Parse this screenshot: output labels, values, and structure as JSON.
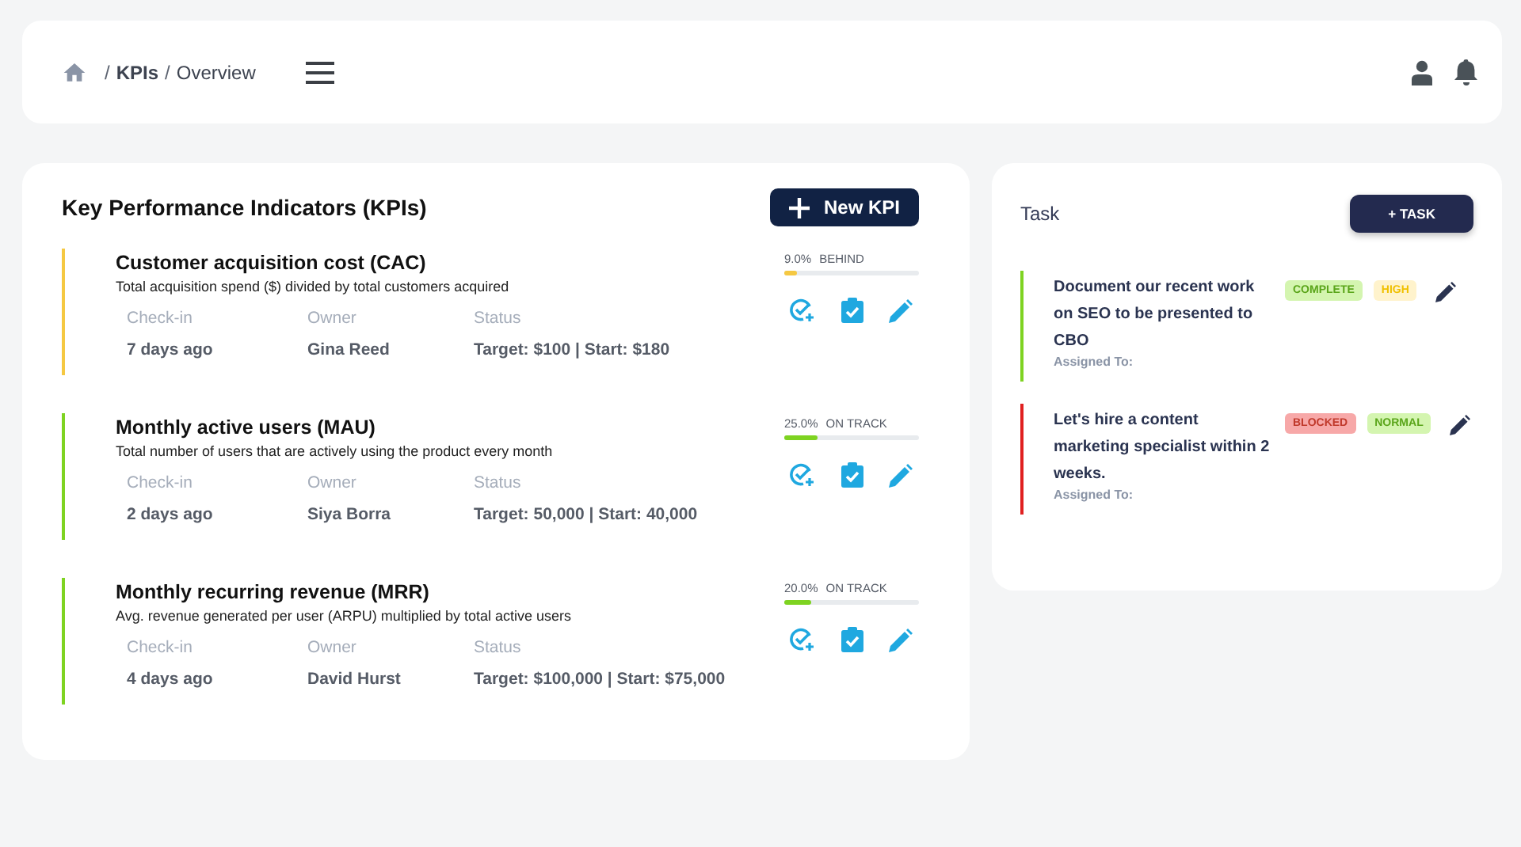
{
  "breadcrumb": {
    "separator": "/",
    "items": [
      {
        "label": "KPIs",
        "current": false
      },
      {
        "label": "Overview",
        "current": true
      }
    ]
  },
  "kpi_panel": {
    "title": "Key Performance Indicators (KPIs)",
    "new_button": "New KPI",
    "kpis": [
      {
        "title": "Customer acquisition cost (CAC)",
        "description": "Total acquisition spend ($) divided by total customers acquired",
        "color": "#f5c842",
        "percent": "9.0%",
        "status": "BEHIND",
        "level": 0.09,
        "checkin_label": "Check-in",
        "owner_label": "Owner",
        "status_label": "Status",
        "checkin": "7 days ago",
        "owner": "Gina Reed",
        "target": "Target: $100 | Start: $180"
      },
      {
        "title": "Monthly active users (MAU)",
        "description": "Total number of users that are actively using the product every month",
        "color": "#7ed321",
        "percent": "25.0%",
        "status": "ON TRACK",
        "level": 0.25,
        "checkin_label": "Check-in",
        "owner_label": "Owner",
        "status_label": "Status",
        "checkin": "2 days ago",
        "owner": "Siya Borra",
        "target": "Target: 50,000 | Start: 40,000"
      },
      {
        "title": "Monthly recurring revenue (MRR)",
        "description": "Avg. revenue generated per user (ARPU) multiplied by total active users",
        "color": "#7ed321",
        "percent": "20.0%",
        "status": "ON TRACK",
        "level": 0.2,
        "checkin_label": "Check-in",
        "owner_label": "Owner",
        "status_label": "Status",
        "checkin": "4 days ago",
        "owner": "David Hurst",
        "target": "Target: $100,000 | Start: $75,000"
      }
    ]
  },
  "task_panel": {
    "title": "Task",
    "add_button": "+ TASK",
    "tasks": [
      {
        "text": "Document our recent work on SEO to be presented to CBO",
        "assigned_label": "Assigned To:",
        "color": "#7ed321",
        "tags": [
          {
            "label": "COMPLETE",
            "color": "#d4f5b0"
          },
          {
            "label": "HIGH",
            "color": "#fff3cc"
          }
        ]
      },
      {
        "text": "Let's hire a content marketing specialist within 2 weeks.",
        "assigned_label": "Assigned To:",
        "color": "#e02020",
        "tags": [
          {
            "label": "BLOCKED",
            "color": "#f7a8a8"
          },
          {
            "label": "NORMAL",
            "color": "#d4f5b0"
          }
        ]
      }
    ]
  }
}
